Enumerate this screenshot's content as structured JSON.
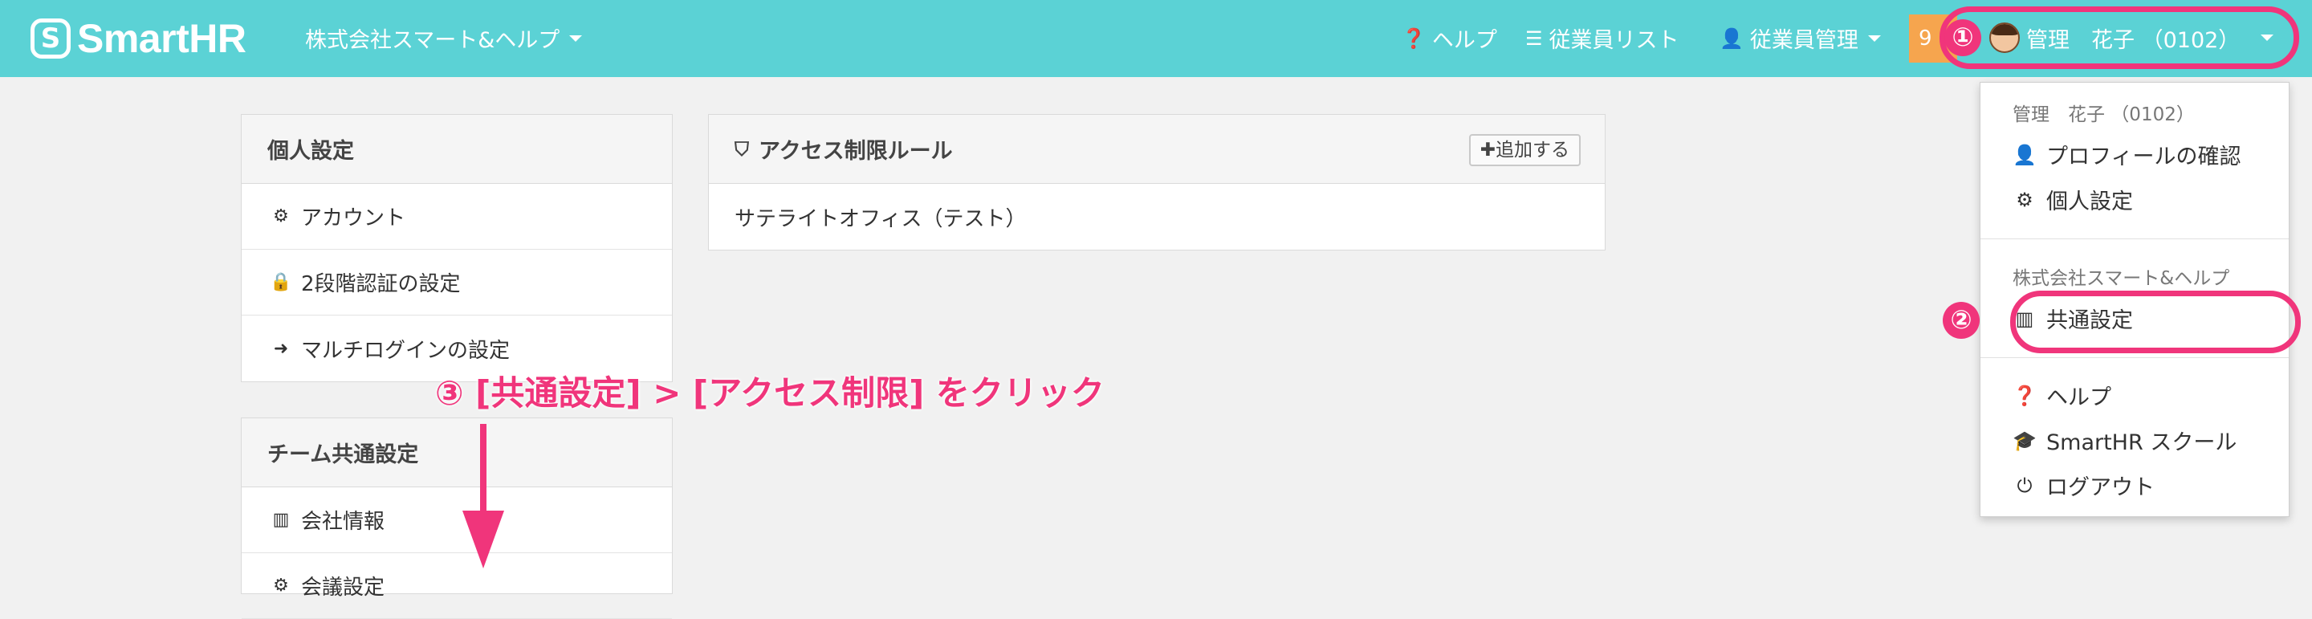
{
  "header": {
    "logo_text": "SmartHR",
    "company": "株式会社スマート&ヘルプ",
    "nav": {
      "help": "ヘルプ",
      "employee_list": "従業員リスト",
      "employee_mgmt": "従業員管理"
    },
    "badge": "9",
    "user": "管理　花子 （0102）"
  },
  "personal_settings": {
    "title": "個人設定",
    "items": [
      "アカウント",
      "2段階認証の設定",
      "マルチログインの設定"
    ]
  },
  "team_settings": {
    "title": "チーム共通設定",
    "items": [
      "会社情報",
      "会議設定"
    ]
  },
  "access_rules": {
    "title": "アクセス制限ルール",
    "add_button": "追加する",
    "rows": [
      "サテライトオフィス（テスト）"
    ]
  },
  "dropdown": {
    "user_header": "管理　花子 （0102）",
    "profile": "プロフィールの確認",
    "personal": "個人設定",
    "company_header": "株式会社スマート&ヘルプ",
    "common": "共通設定",
    "help": "ヘルプ",
    "school": "SmartHR スクール",
    "logout": "ログアウト"
  },
  "annotations": {
    "step1": "①",
    "step2": "②",
    "step3": "③ [共通設定] > [アクセス制限] をクリック"
  },
  "colors": {
    "header": "#5bd2d5",
    "highlight": "#f0357b",
    "badge": "#f6a54e"
  }
}
